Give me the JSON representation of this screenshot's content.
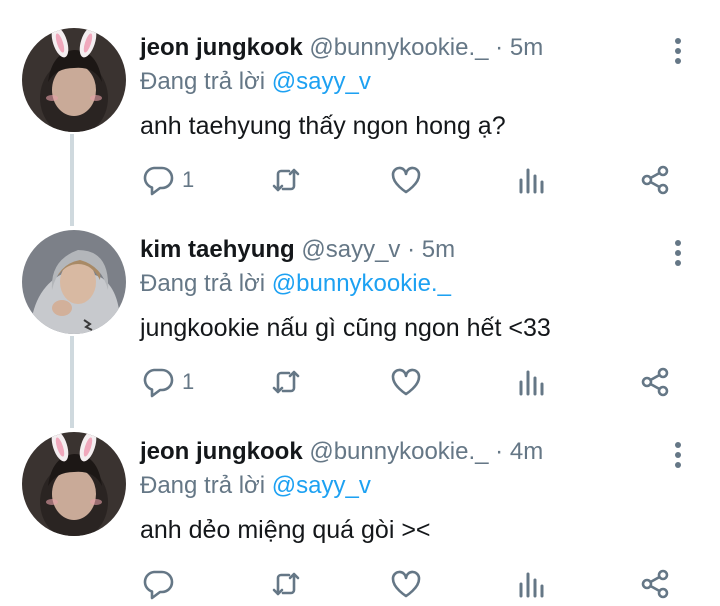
{
  "tweets": [
    {
      "name": "jeon jungkook",
      "handle": "@bunnykookie._",
      "separator": "·",
      "time": "5m",
      "reply_prefix": "Đang trả lời",
      "reply_to": "@sayy_v",
      "text": "anh taehyung thấy ngon hong ạ?",
      "reply_count": "1"
    },
    {
      "name": "kim taehyung",
      "handle": "@sayy_v",
      "separator": "·",
      "time": "5m",
      "reply_prefix": "Đang trả lời",
      "reply_to": "@bunnykookie._",
      "text": "jungkookie nấu gì cũng ngon hết <33",
      "reply_count": "1"
    },
    {
      "name": "jeon jungkook",
      "handle": "@bunnykookie._",
      "separator": "·",
      "time": "4m",
      "reply_prefix": "Đang trả lời",
      "reply_to": "@sayy_v",
      "text": "anh dẻo miệng quá gòi ><",
      "reply_count": ""
    }
  ],
  "icons": {
    "more": "more-vertical-icon",
    "reply": "reply-icon",
    "retweet": "retweet-icon",
    "like": "heart-icon",
    "analytics": "analytics-icon",
    "share": "share-icon"
  },
  "colors": {
    "name": "#14171a",
    "secondary": "#657786",
    "link": "#1da1f2",
    "thread_line": "#cfd9de"
  }
}
